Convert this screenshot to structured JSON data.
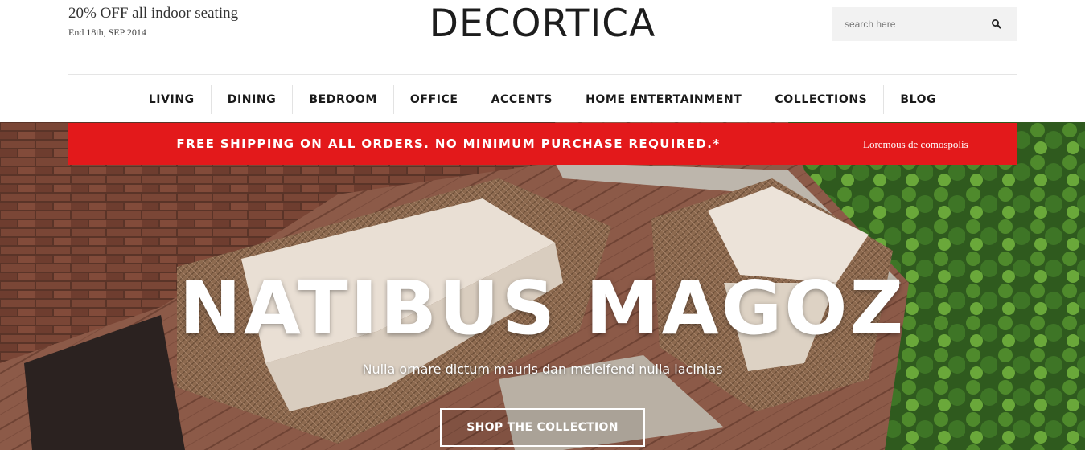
{
  "promo": {
    "title": "20% OFF all indoor seating",
    "subtitle": "End 18th, SEP 2014"
  },
  "brand": {
    "logo": "DECORTICA"
  },
  "search": {
    "placeholder": "search here",
    "icon": "search-icon"
  },
  "nav": {
    "items": [
      "LIVING",
      "DINING",
      "BEDROOM",
      "OFFICE",
      "ACCENTS",
      "HOME ENTERTAINMENT",
      "COLLECTIONS",
      "BLOG"
    ]
  },
  "shipping_bar": {
    "text": "FREE SHIPPING ON ALL ORDERS. NO MINIMUM PURCHASE REQUIRED.*",
    "link": "Loremous de comospolis",
    "color": "#e3191b"
  },
  "hero": {
    "title": "NATIBUS MAGOZ",
    "subtitle": "Nulla ornare dictum mauris dan meleifend nulla lacinias",
    "button": "SHOP THE COLLECTION"
  }
}
